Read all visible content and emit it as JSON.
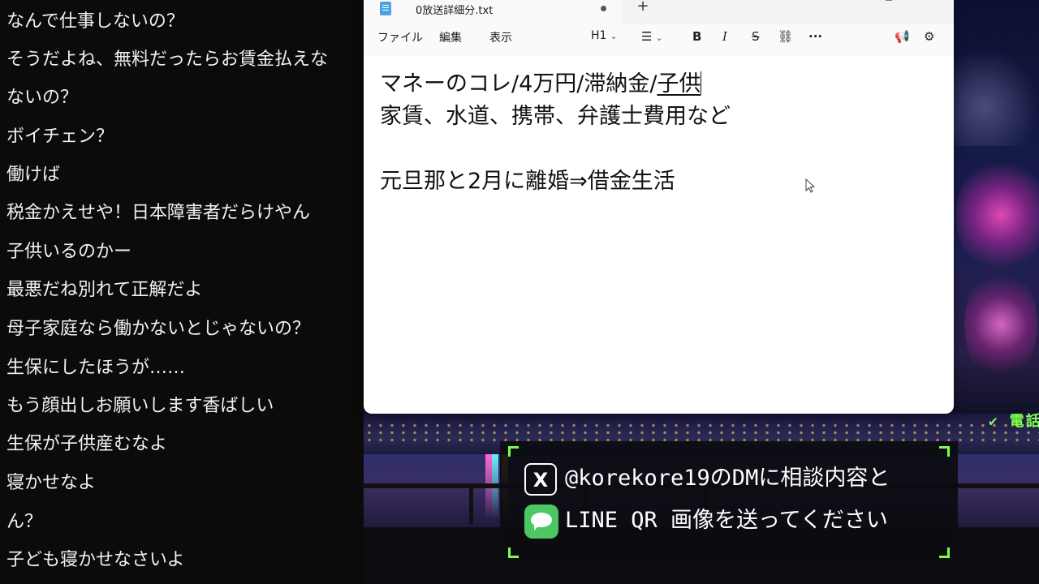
{
  "chat": {
    "messages": [
      "なんで仕事しないの？",
      "そうだよね、無料だったらお賃金払えな",
      "ないの？",
      "ボイチェン？",
      "働けば",
      "税金かえせや！日本障害者だらけやん",
      "子供いるのかー",
      "最悪だね別れて正解だよ",
      "母子家庭なら働かないとじゃないの？",
      "生保にしたほうが……",
      "もう顔出しお願いします香ばしい",
      "生保が子供産むなよ",
      "寝かせなよ",
      "ん？",
      "子ども寝かせなさいよ"
    ]
  },
  "notepad": {
    "tab_title": "0放送詳細分.txt",
    "new_tab": "+",
    "menus": [
      "ファイル",
      "編集",
      "表示"
    ],
    "heading_tool": "H1",
    "tools": {
      "bold": "B",
      "italic": "I",
      "strike": "S",
      "more": "···"
    },
    "line1_prefix": "マネーのコレ/4万円/滞納金/",
    "line1_underlined": "子供",
    "line2": "家賃、水道、携帯、弁護士費用など",
    "line4": "元旦那と2月に離婚⇒借金生活"
  },
  "contact": {
    "row1_icon": "X",
    "row1_text": "@korekore19のDMに相談内容と",
    "row2_text": "LINE QR 画像を送ってください"
  },
  "background": {
    "banner_text": "✔ 電話相談受付中"
  }
}
